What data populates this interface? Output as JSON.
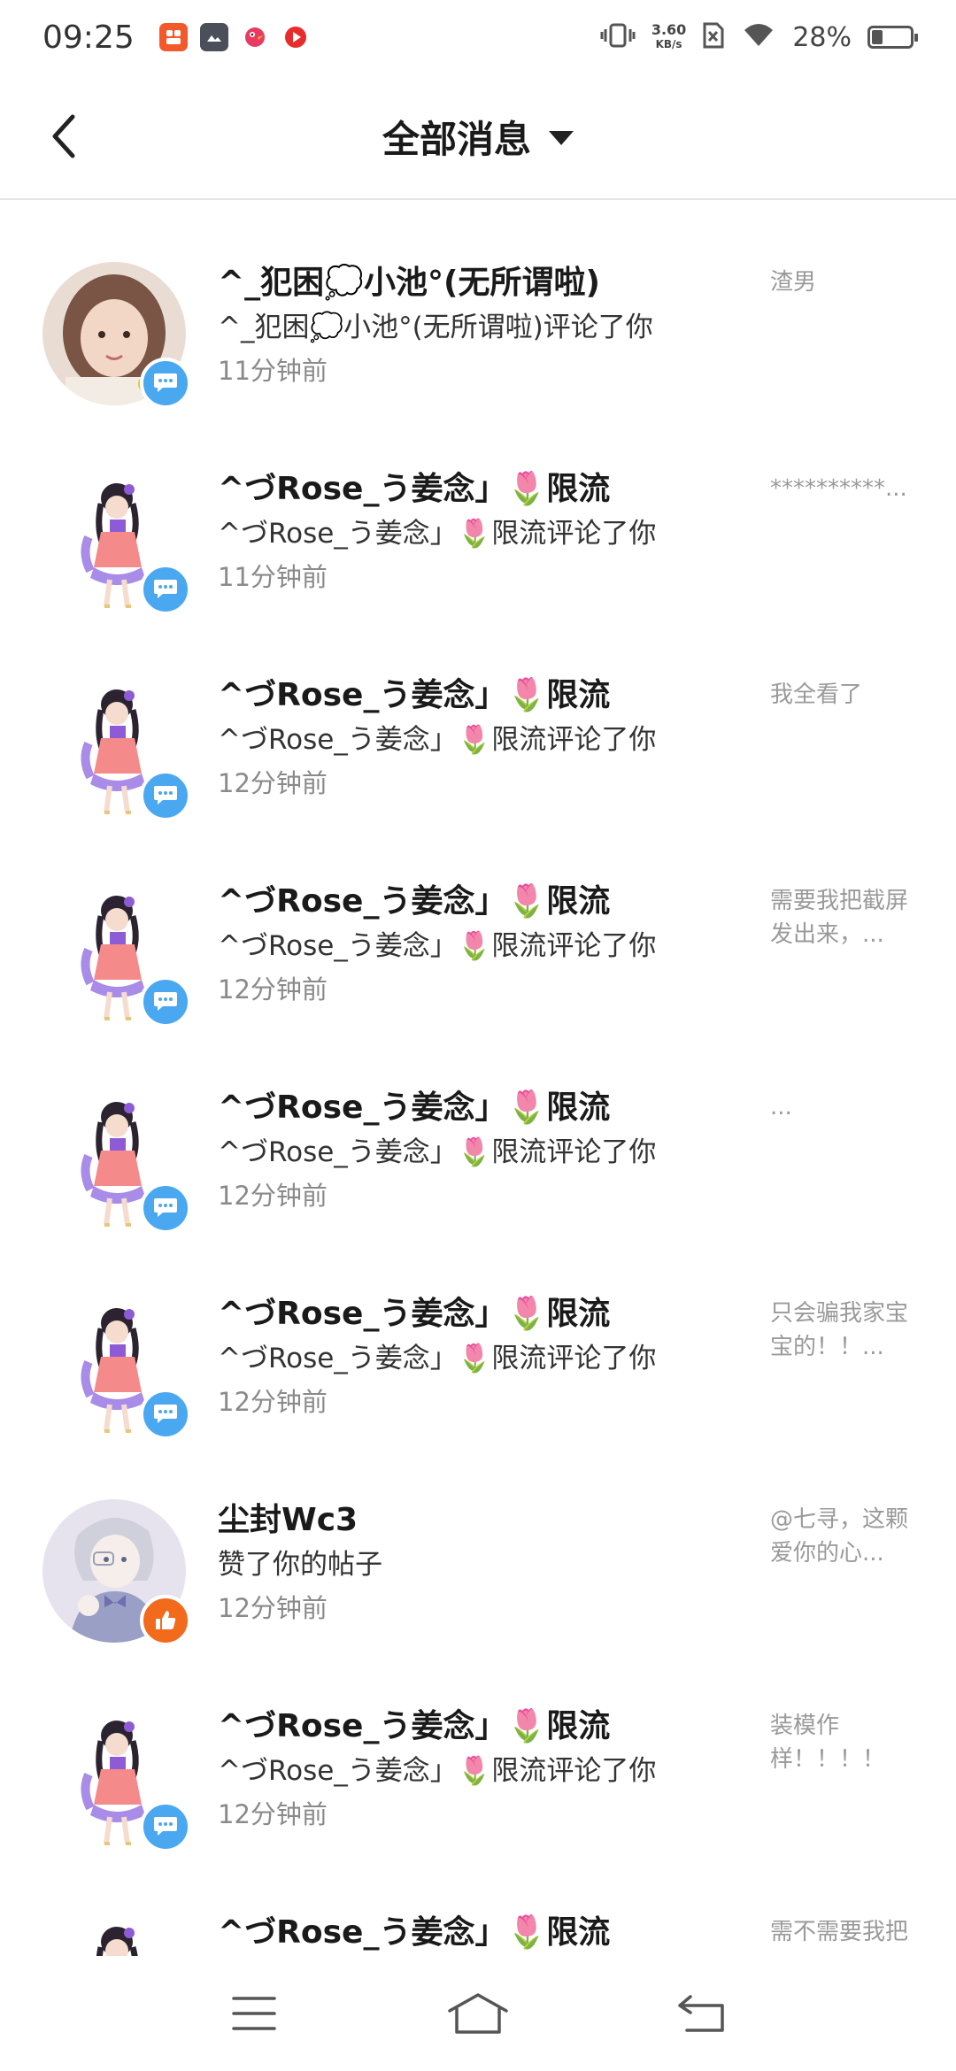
{
  "status_bar": {
    "time": "09:25",
    "net_speed_value": "3.60",
    "net_speed_unit": "KB/s",
    "battery_percent": "28%",
    "battery_level": 0.28,
    "app_icons": [
      "red-app-icon",
      "gallery-app-icon",
      "bird-app-icon",
      "video-app-icon"
    ]
  },
  "header": {
    "title": "全部消息"
  },
  "messages": [
    {
      "name": "^_犯困💭小池°(无所谓啦)",
      "action": "^_犯困💭小池°(无所谓啦)评论了你",
      "time": "11分钟前",
      "preview": "渣男",
      "type": "comment",
      "avatar": "girl-photo"
    },
    {
      "name": "^づRose_う姜念」🌷限流",
      "action": "^づRose_う姜念」🌷限流评论了你",
      "time": "11分钟前",
      "preview": "**********...",
      "type": "comment",
      "avatar": "anime-girl"
    },
    {
      "name": "^づRose_う姜念」🌷限流",
      "action": "^づRose_う姜念」🌷限流评论了你",
      "time": "12分钟前",
      "preview": "我全看了",
      "type": "comment",
      "avatar": "anime-girl"
    },
    {
      "name": "^づRose_う姜念」🌷限流",
      "action": "^づRose_う姜念」🌷限流评论了你",
      "time": "12分钟前",
      "preview": "需要我把截屏发出来，...",
      "type": "comment",
      "avatar": "anime-girl"
    },
    {
      "name": "^づRose_う姜念」🌷限流",
      "action": "^づRose_う姜念」🌷限流评论了你",
      "time": "12分钟前",
      "preview": "...",
      "type": "comment",
      "avatar": "anime-girl"
    },
    {
      "name": "^づRose_う姜念」🌷限流",
      "action": "^づRose_う姜念」🌷限流评论了你",
      "time": "12分钟前",
      "preview": "只会骗我家宝宝的！！...",
      "type": "comment",
      "avatar": "anime-girl"
    },
    {
      "name": "尘封Wc3",
      "action": "赞了你的帖子",
      "time": "12分钟前",
      "preview": "@七寻，这颗爱你的心...",
      "type": "like",
      "avatar": "anime-boy"
    },
    {
      "name": "^づRose_う姜念」🌷限流",
      "action": "^づRose_う姜念」🌷限流评论了你",
      "time": "12分钟前",
      "preview": "装模作样！！！！",
      "type": "comment",
      "avatar": "anime-girl"
    },
    {
      "name": "^づRose_う姜念」🌷限流",
      "action": "",
      "time": "",
      "preview": "需不需要我把",
      "type": "comment",
      "avatar": "anime-girl"
    }
  ],
  "bottom_nav": {
    "items": [
      "menu-icon",
      "home-icon",
      "back-nav-icon"
    ]
  },
  "colors": {
    "comment_badge": "#4aa8f0",
    "like_badge": "#f26a1b",
    "secondary_text": "#8a8a8a"
  }
}
